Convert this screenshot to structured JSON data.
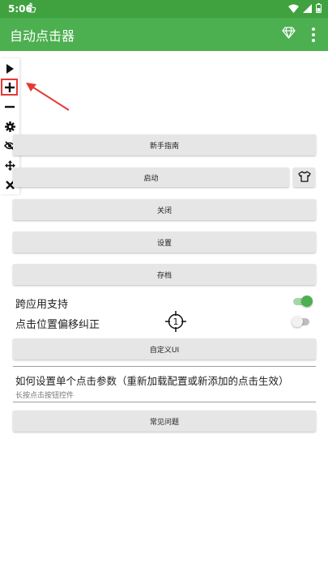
{
  "status_bar": {
    "time": "5:06"
  },
  "app_bar": {
    "title": "自动点击器"
  },
  "toolbar": {
    "items": [
      {
        "icon": "play-icon"
      },
      {
        "icon": "plus-icon"
      },
      {
        "icon": "minus-icon"
      },
      {
        "icon": "gear-icon"
      },
      {
        "icon": "eye-off-icon"
      },
      {
        "icon": "move-icon"
      },
      {
        "icon": "close-icon"
      }
    ]
  },
  "main": {
    "guide_button": "新手指南",
    "start_button": "启动",
    "close_button": "关闭",
    "settings_button": "设置",
    "archive_button": "存档",
    "cross_app_label": "跨应用支持",
    "cross_app_enabled": true,
    "offset_label": "点击位置偏移纠正",
    "offset_enabled": false,
    "crosshair_number": "1",
    "custom_ui_button": "自定义UI",
    "help_title": "如何设置单个点击参数（重新加载配置或新添加的点击生效）",
    "help_subtitle": "长按点击按钮控件",
    "faq_button": "常见问题"
  },
  "colors": {
    "primary": "#4caf50",
    "status_bar": "#3fa23f",
    "switch_on": "#4caf50",
    "highlight": "#e53935"
  }
}
